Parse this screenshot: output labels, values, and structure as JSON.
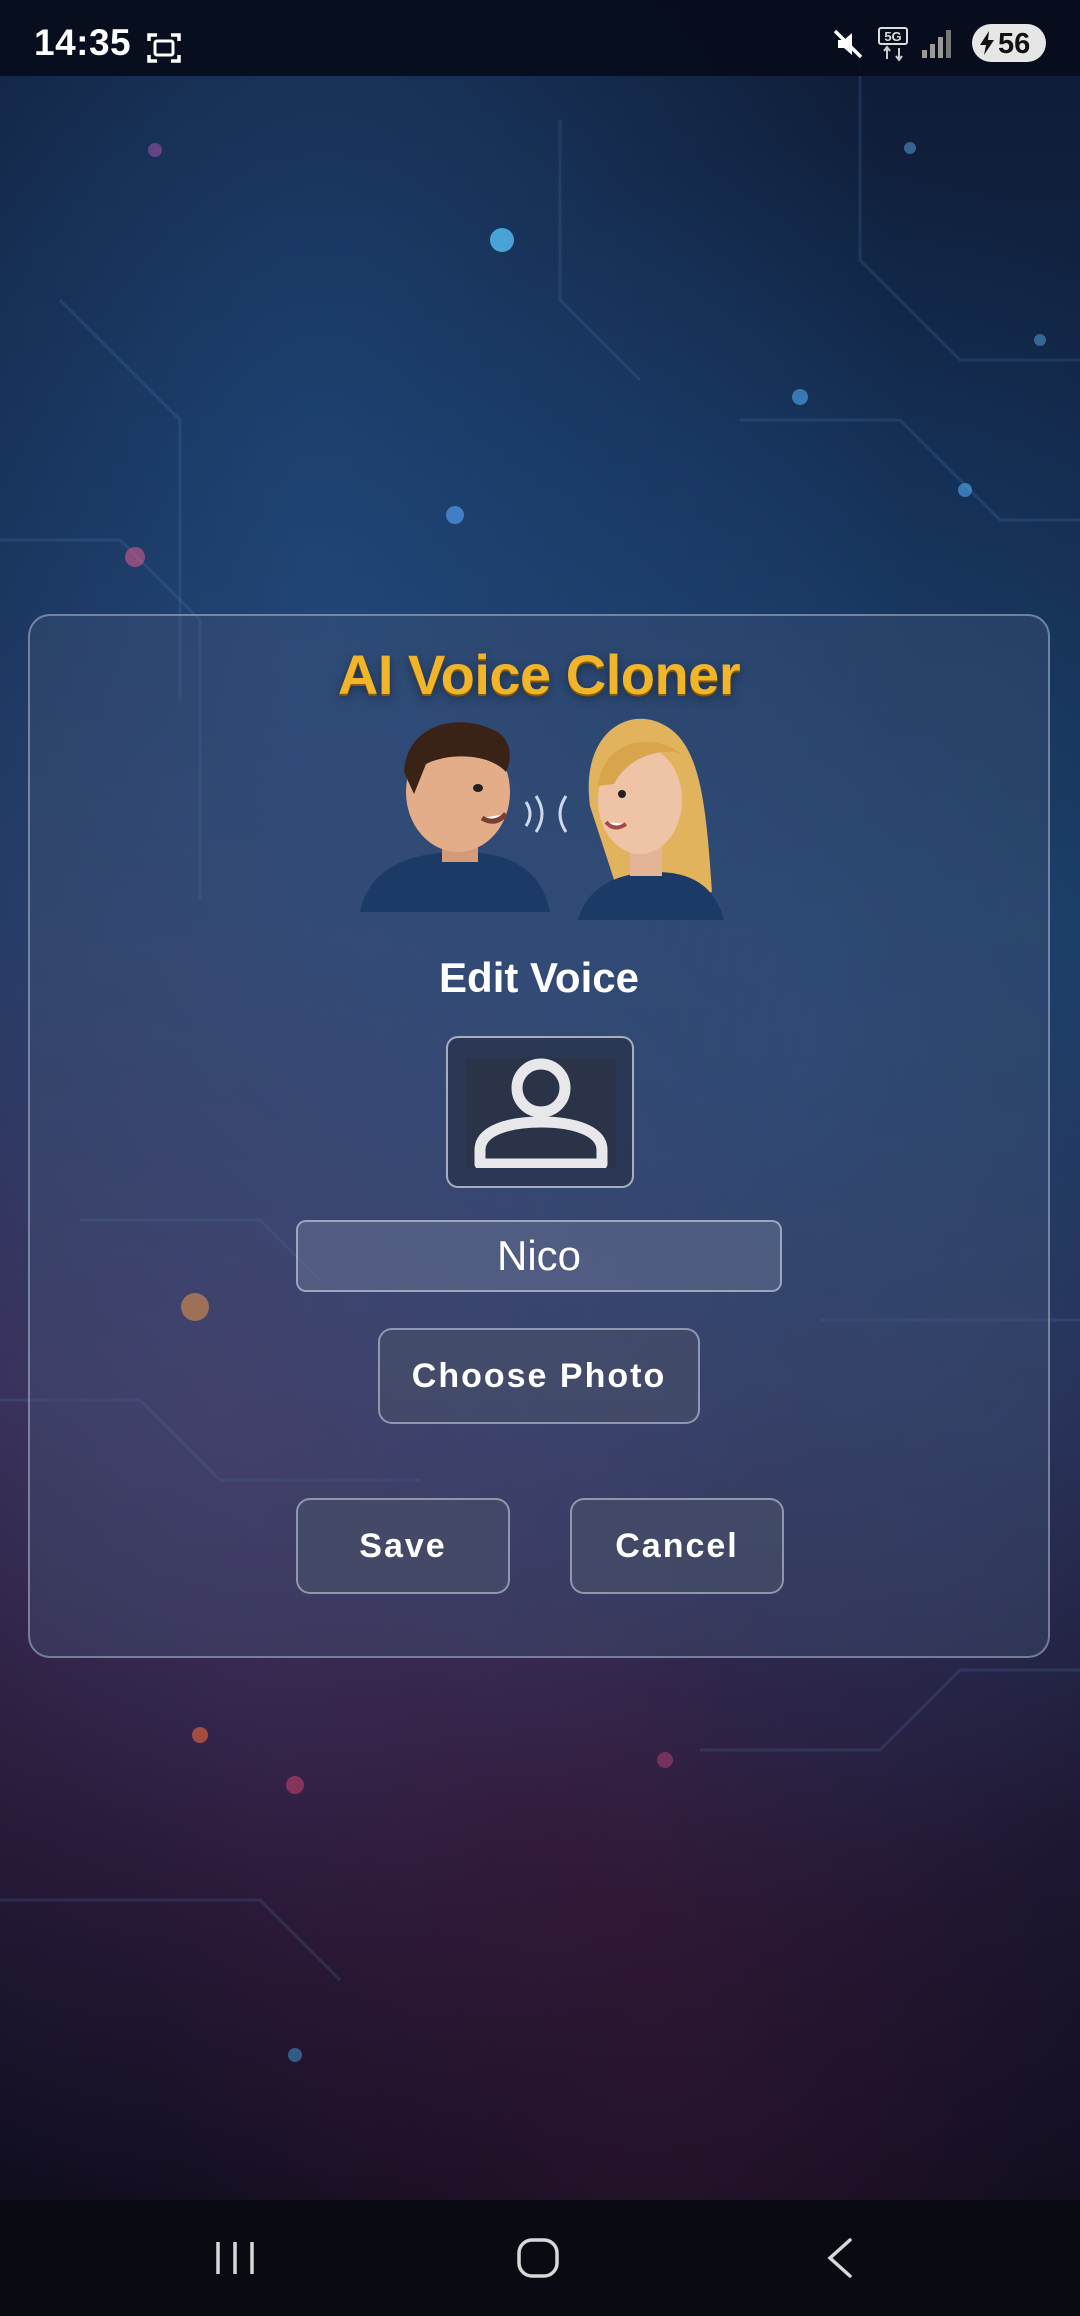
{
  "status_bar": {
    "time": "14:35",
    "network": "5G",
    "battery": "56",
    "icons": [
      "screenshot-icon",
      "mute-icon",
      "5g-icon",
      "signal-icon",
      "battery-icon"
    ]
  },
  "card": {
    "app_title": "AI Voice Cloner",
    "heading": "Edit Voice",
    "avatar_icon": "person-icon",
    "name_value": "Nico",
    "choose_photo_label": "Choose Photo",
    "save_label": "Save",
    "cancel_label": "Cancel"
  },
  "nav_bar": {
    "icons": [
      "recent-apps-icon",
      "home-icon",
      "back-icon"
    ]
  },
  "colors": {
    "title_gold": "#f0b52a",
    "background_dark": "#0e1a33"
  }
}
